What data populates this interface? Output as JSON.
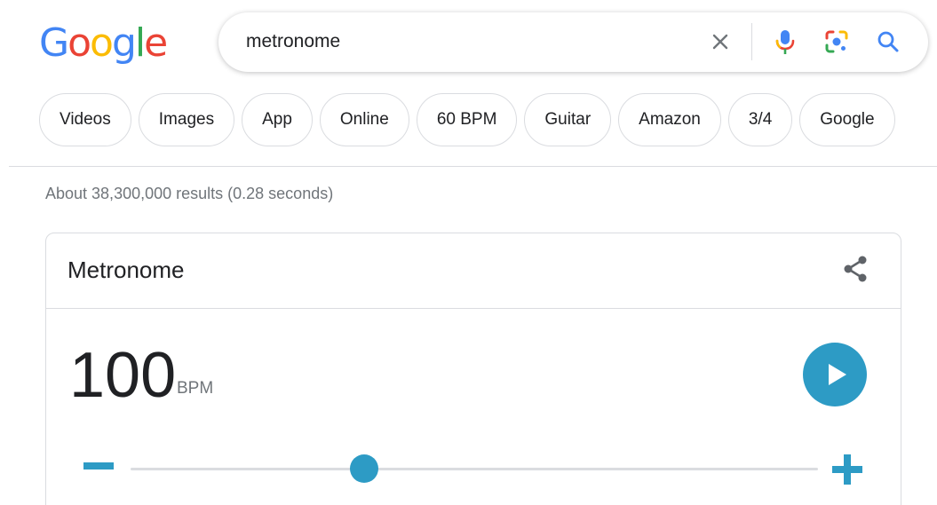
{
  "logo": {
    "letters": [
      {
        "ch": "G",
        "color": "#4285F4"
      },
      {
        "ch": "o",
        "color": "#EA4335"
      },
      {
        "ch": "o",
        "color": "#FBBC05"
      },
      {
        "ch": "g",
        "color": "#4285F4"
      },
      {
        "ch": "l",
        "color": "#34A853"
      },
      {
        "ch": "e",
        "color": "#EA4335"
      }
    ]
  },
  "search": {
    "query": "metronome"
  },
  "chips": [
    "Videos",
    "Images",
    "App",
    "Online",
    "60 BPM",
    "Guitar",
    "Amazon",
    "3/4",
    "Google"
  ],
  "results_stats": "About 38,300,000 results (0.28 seconds)",
  "metronome": {
    "title": "Metronome",
    "bpm": "100",
    "unit": "BPM",
    "slider_fraction": 0.34
  },
  "colors": {
    "accent": "#2d9bc5",
    "blue": "#4285F4",
    "red": "#EA4335",
    "yellow": "#FBBC05",
    "green": "#34A853"
  },
  "icons": {
    "clear": "close-icon",
    "voice": "microphone-icon",
    "lens": "lens-camera-icon",
    "search": "search-icon",
    "share": "share-icon",
    "play": "play-icon",
    "decrease": "minus-icon",
    "increase": "plus-icon"
  }
}
